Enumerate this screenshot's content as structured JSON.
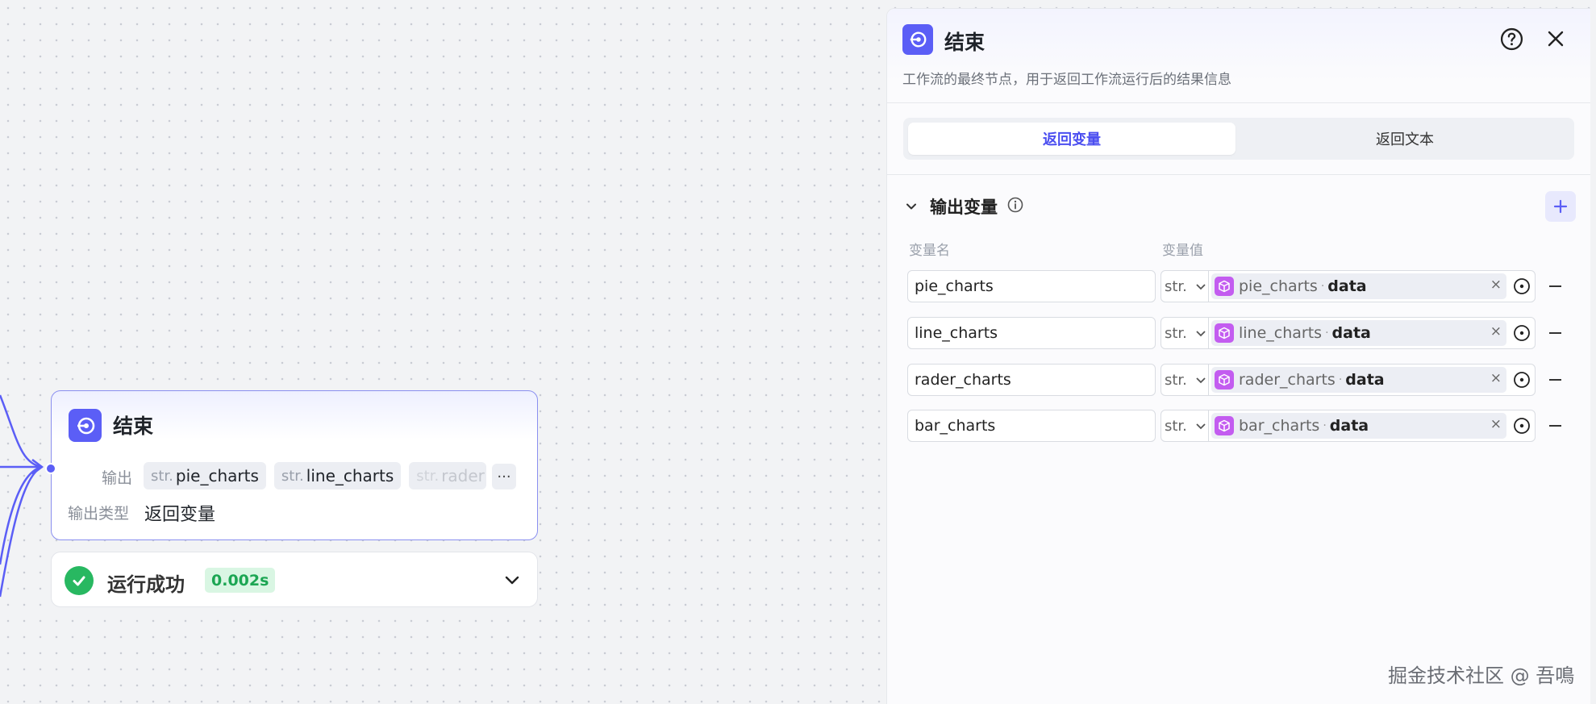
{
  "node": {
    "title": "结束",
    "output_label": "输出",
    "output_type_label": "输出类型",
    "output_type_value": "返回变量",
    "tags": [
      {
        "type": "str.",
        "name": "pie_charts"
      },
      {
        "type": "str.",
        "name": "line_charts"
      },
      {
        "type": "str.",
        "name": "rader"
      }
    ],
    "more_label": "···"
  },
  "status": {
    "text": "运行成功",
    "time": "0.002s"
  },
  "panel": {
    "title": "结束",
    "description": "工作流的最终节点，用于返回工作流运行后的结果信息",
    "tabs": [
      {
        "label": "返回变量",
        "active": true
      },
      {
        "label": "返回文本",
        "active": false
      }
    ],
    "section_title": "输出变量",
    "columns": {
      "name": "变量名",
      "value": "变量值"
    },
    "rows": [
      {
        "name": "pie_charts",
        "type": "str.",
        "source": "pie_charts",
        "field": "data"
      },
      {
        "name": "line_charts",
        "type": "str.",
        "source": "line_charts",
        "field": "data"
      },
      {
        "name": "rader_charts",
        "type": "str.",
        "source": "rader_charts",
        "field": "data"
      },
      {
        "name": "bar_charts",
        "type": "str.",
        "source": "bar_charts",
        "field": "data"
      }
    ],
    "remove_glyph": "×",
    "dot_glyph": "·"
  },
  "watermark": "掘金技术社区 @ 吾鳴",
  "colors": {
    "accent": "#5b5ef6",
    "success": "#28b861",
    "variable_icon": "#c35cf0"
  },
  "icons": [
    "end-node-icon",
    "help-icon",
    "close-icon",
    "chevron-down-icon",
    "info-icon",
    "plus-icon",
    "cube-icon",
    "target-icon",
    "minus-icon",
    "check-icon"
  ]
}
